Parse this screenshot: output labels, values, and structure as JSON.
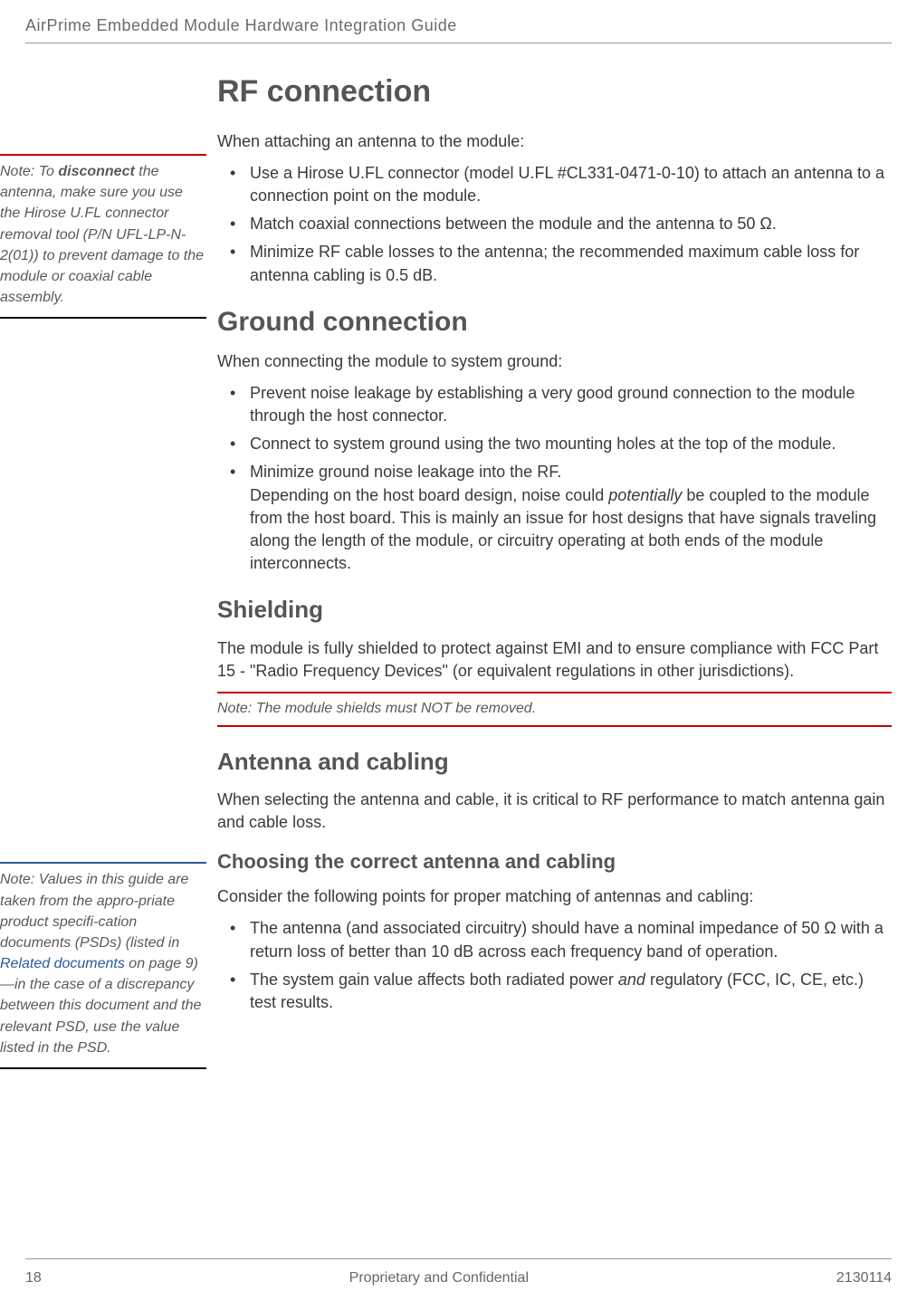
{
  "header": {
    "title": "AirPrime Embedded Module Hardware Integration Guide"
  },
  "sidenotes": {
    "n1": {
      "prefix": "Note:  To ",
      "bold": "disconnect",
      "rest": " the antenna, make sure you use the Hirose U.FL connector removal tool (P/N UFL-LP-N-2(01)) to prevent damage to the module or coaxial cable assembly."
    },
    "n2": {
      "a": "Note:  Values in this guide are taken from the appro-priate product specifi-cation documents (PSDs) (listed in ",
      "link": "Related documents",
      "b": " on page 9)—in the case of a discrepancy between this document and the relevant PSD, use the value listed in the PSD."
    }
  },
  "sections": {
    "rf": {
      "heading": "RF connection",
      "intro": "When attaching an antenna to the module:",
      "bullets": [
        "Use a Hirose U.FL connector (model U.FL #CL331-0471-0-10) to attach an antenna to a connection point on the module.",
        "Match coaxial connections between the module and the antenna to 50 Ω.",
        "Minimize RF cable losses to the antenna; the recommended maximum cable loss for antenna cabling is 0.5 dB."
      ]
    },
    "ground": {
      "heading": "Ground connection",
      "intro": "When connecting the module to system ground:",
      "bullets": [
        "Prevent noise leakage by establishing a very good ground connection to the module through the host connector.",
        "Connect to system ground using the two mounting holes at the top of the module."
      ],
      "b3a": "Minimize ground noise leakage into the RF.",
      "b3b": "Depending on the host board design, noise could ",
      "b3ital": "potentially",
      "b3c": " be coupled to the module from the host board. This is mainly an issue for host designs that have signals traveling along the length of the module, or circuitry operating at both ends of the module interconnects."
    },
    "shielding": {
      "heading": "Shielding",
      "para": "The module is fully shielded to protect against EMI and to ensure compliance with FCC Part 15 - \"Radio Frequency Devices\" (or equivalent regulations in other jurisdictions).",
      "note": "Note:  The module shields must NOT be removed."
    },
    "antenna": {
      "heading": "Antenna and cabling",
      "para": "When selecting the antenna and cable, it is critical to RF performance to match antenna gain and cable loss.",
      "sub": "Choosing the correct antenna and cabling",
      "subintro": "Consider the following points for proper matching of antennas and cabling:",
      "b1": "The antenna (and associated circuitry) should have a nominal impedance of 50 Ω with a return loss of better than 10 dB across each frequency band of operation.",
      "b2a": "The system gain value affects both radiated power ",
      "b2ital": "and",
      "b2b": " regulatory (FCC, IC, CE, etc.) test results."
    }
  },
  "footer": {
    "page": "18",
    "mid": "Proprietary and Confidential",
    "right": "2130114"
  }
}
